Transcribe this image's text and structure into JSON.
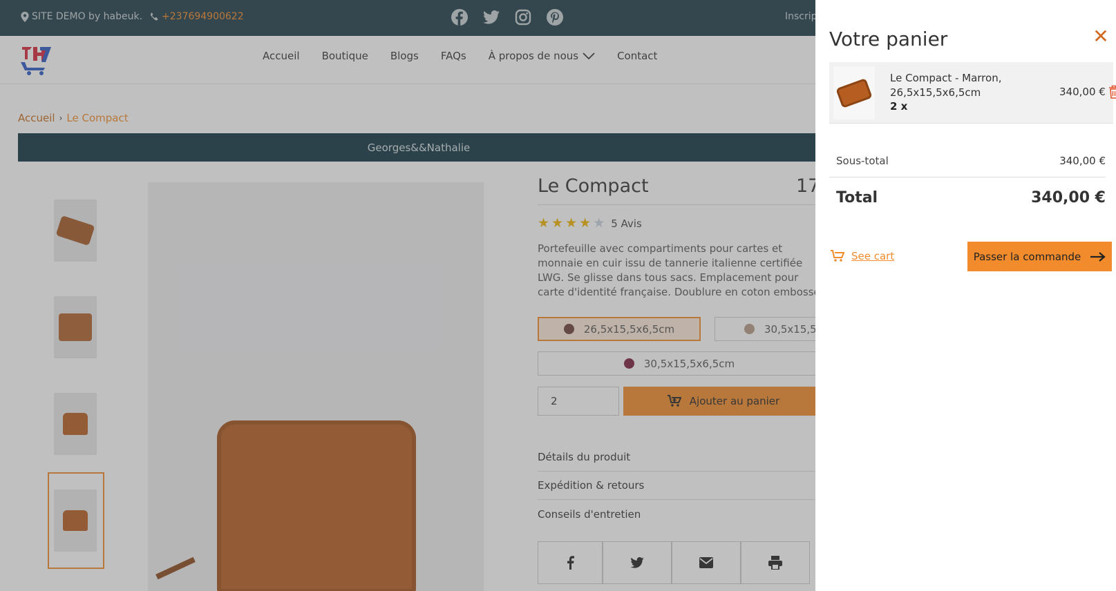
{
  "topbar": {
    "location": "SITE  DEMO by habeuk.",
    "phone": "+237694900622",
    "socials": [
      "facebook-icon",
      "twitter-icon",
      "instagram-icon",
      "pinterest-icon"
    ],
    "login": "Inscrip"
  },
  "nav": {
    "items": [
      "Accueil",
      "Boutique",
      "Blogs",
      "FAQs",
      "À propos de nous",
      "Contact"
    ]
  },
  "breadcrumb": {
    "home": "Accueil",
    "current": "Le Compact"
  },
  "banner": "Georges&&Nathalie",
  "product": {
    "title": "Le Compact",
    "price_partial": "17",
    "rating": 4,
    "reviews": "5 Avis",
    "description": "Portefeuille avec compartiments pour cartes et monnaie en cuir issu de tannerie italienne certifiée  LWG. Se glisse dans tous sacs. Emplacement pour carte d'identité française.  Doublure en coton embossé à chaud.",
    "variants": [
      {
        "label": "26,5x15,5x6,5cm",
        "color": "#6b3f38",
        "selected": true
      },
      {
        "label": "30,5x15,5x",
        "color": "#b59a85",
        "selected": false
      },
      {
        "label": "30,5x15,5x6,5cm",
        "color": "#7a1f3d",
        "selected": false
      }
    ],
    "quantity": "2",
    "add_to_cart": "Ajouter au panier",
    "accordion": [
      "Détails du produit",
      "Expédition & retours",
      "Conseils d'entretien"
    ]
  },
  "cart": {
    "title": "Votre panier",
    "item": {
      "name": "Le Compact -  Marron, 26,5x15,5x6,5cm",
      "qty": "2 x",
      "price": "340,00 €"
    },
    "subtotal_label": "Sous-total",
    "subtotal": "340,00 €",
    "total_label": "Total",
    "total": "340,00 €",
    "see_cart": "See cart",
    "checkout": "Passer la commande"
  },
  "colors": {
    "accent": "#f28b2b",
    "topbar": "#1d3b47",
    "banner": "#0f3441"
  }
}
